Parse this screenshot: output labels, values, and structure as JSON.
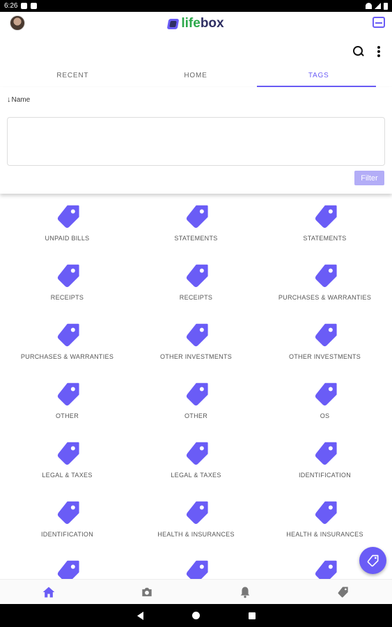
{
  "status_bar": {
    "time": "6:26"
  },
  "app": {
    "logo_part1": "life",
    "logo_part2": "box"
  },
  "tabs": [
    {
      "label": "RECENT",
      "active": false
    },
    {
      "label": "HOME",
      "active": false
    },
    {
      "label": "TAGS",
      "active": true
    }
  ],
  "filter": {
    "sort_label": "Name",
    "input_value": "",
    "button_label": "Filter"
  },
  "tags": [
    "UNPAID BILLS",
    "STATEMENTS",
    "STATEMENTS",
    "RECEIPTS",
    "RECEIPTS",
    "PURCHASES & WARRANTIES",
    "PURCHASES & WARRANTIES",
    "OTHER INVESTMENTS",
    "OTHER INVESTMENTS",
    "OTHER",
    "OTHER",
    "OS",
    "LEGAL & TAXES",
    "LEGAL & TAXES",
    "IDENTIFICATION",
    "IDENTIFICATION",
    "HEALTH & INSURANCES",
    "HEALTH & INSURANCES",
    "",
    "",
    ""
  ],
  "bottom_nav": [
    "home-icon",
    "camera-icon",
    "bell-icon",
    "tag-icon"
  ],
  "colors": {
    "accent": "#6a5cf6",
    "accent_light": "#b3adf7",
    "logo_green": "#2ba84a",
    "logo_dark": "#2f2f63"
  }
}
